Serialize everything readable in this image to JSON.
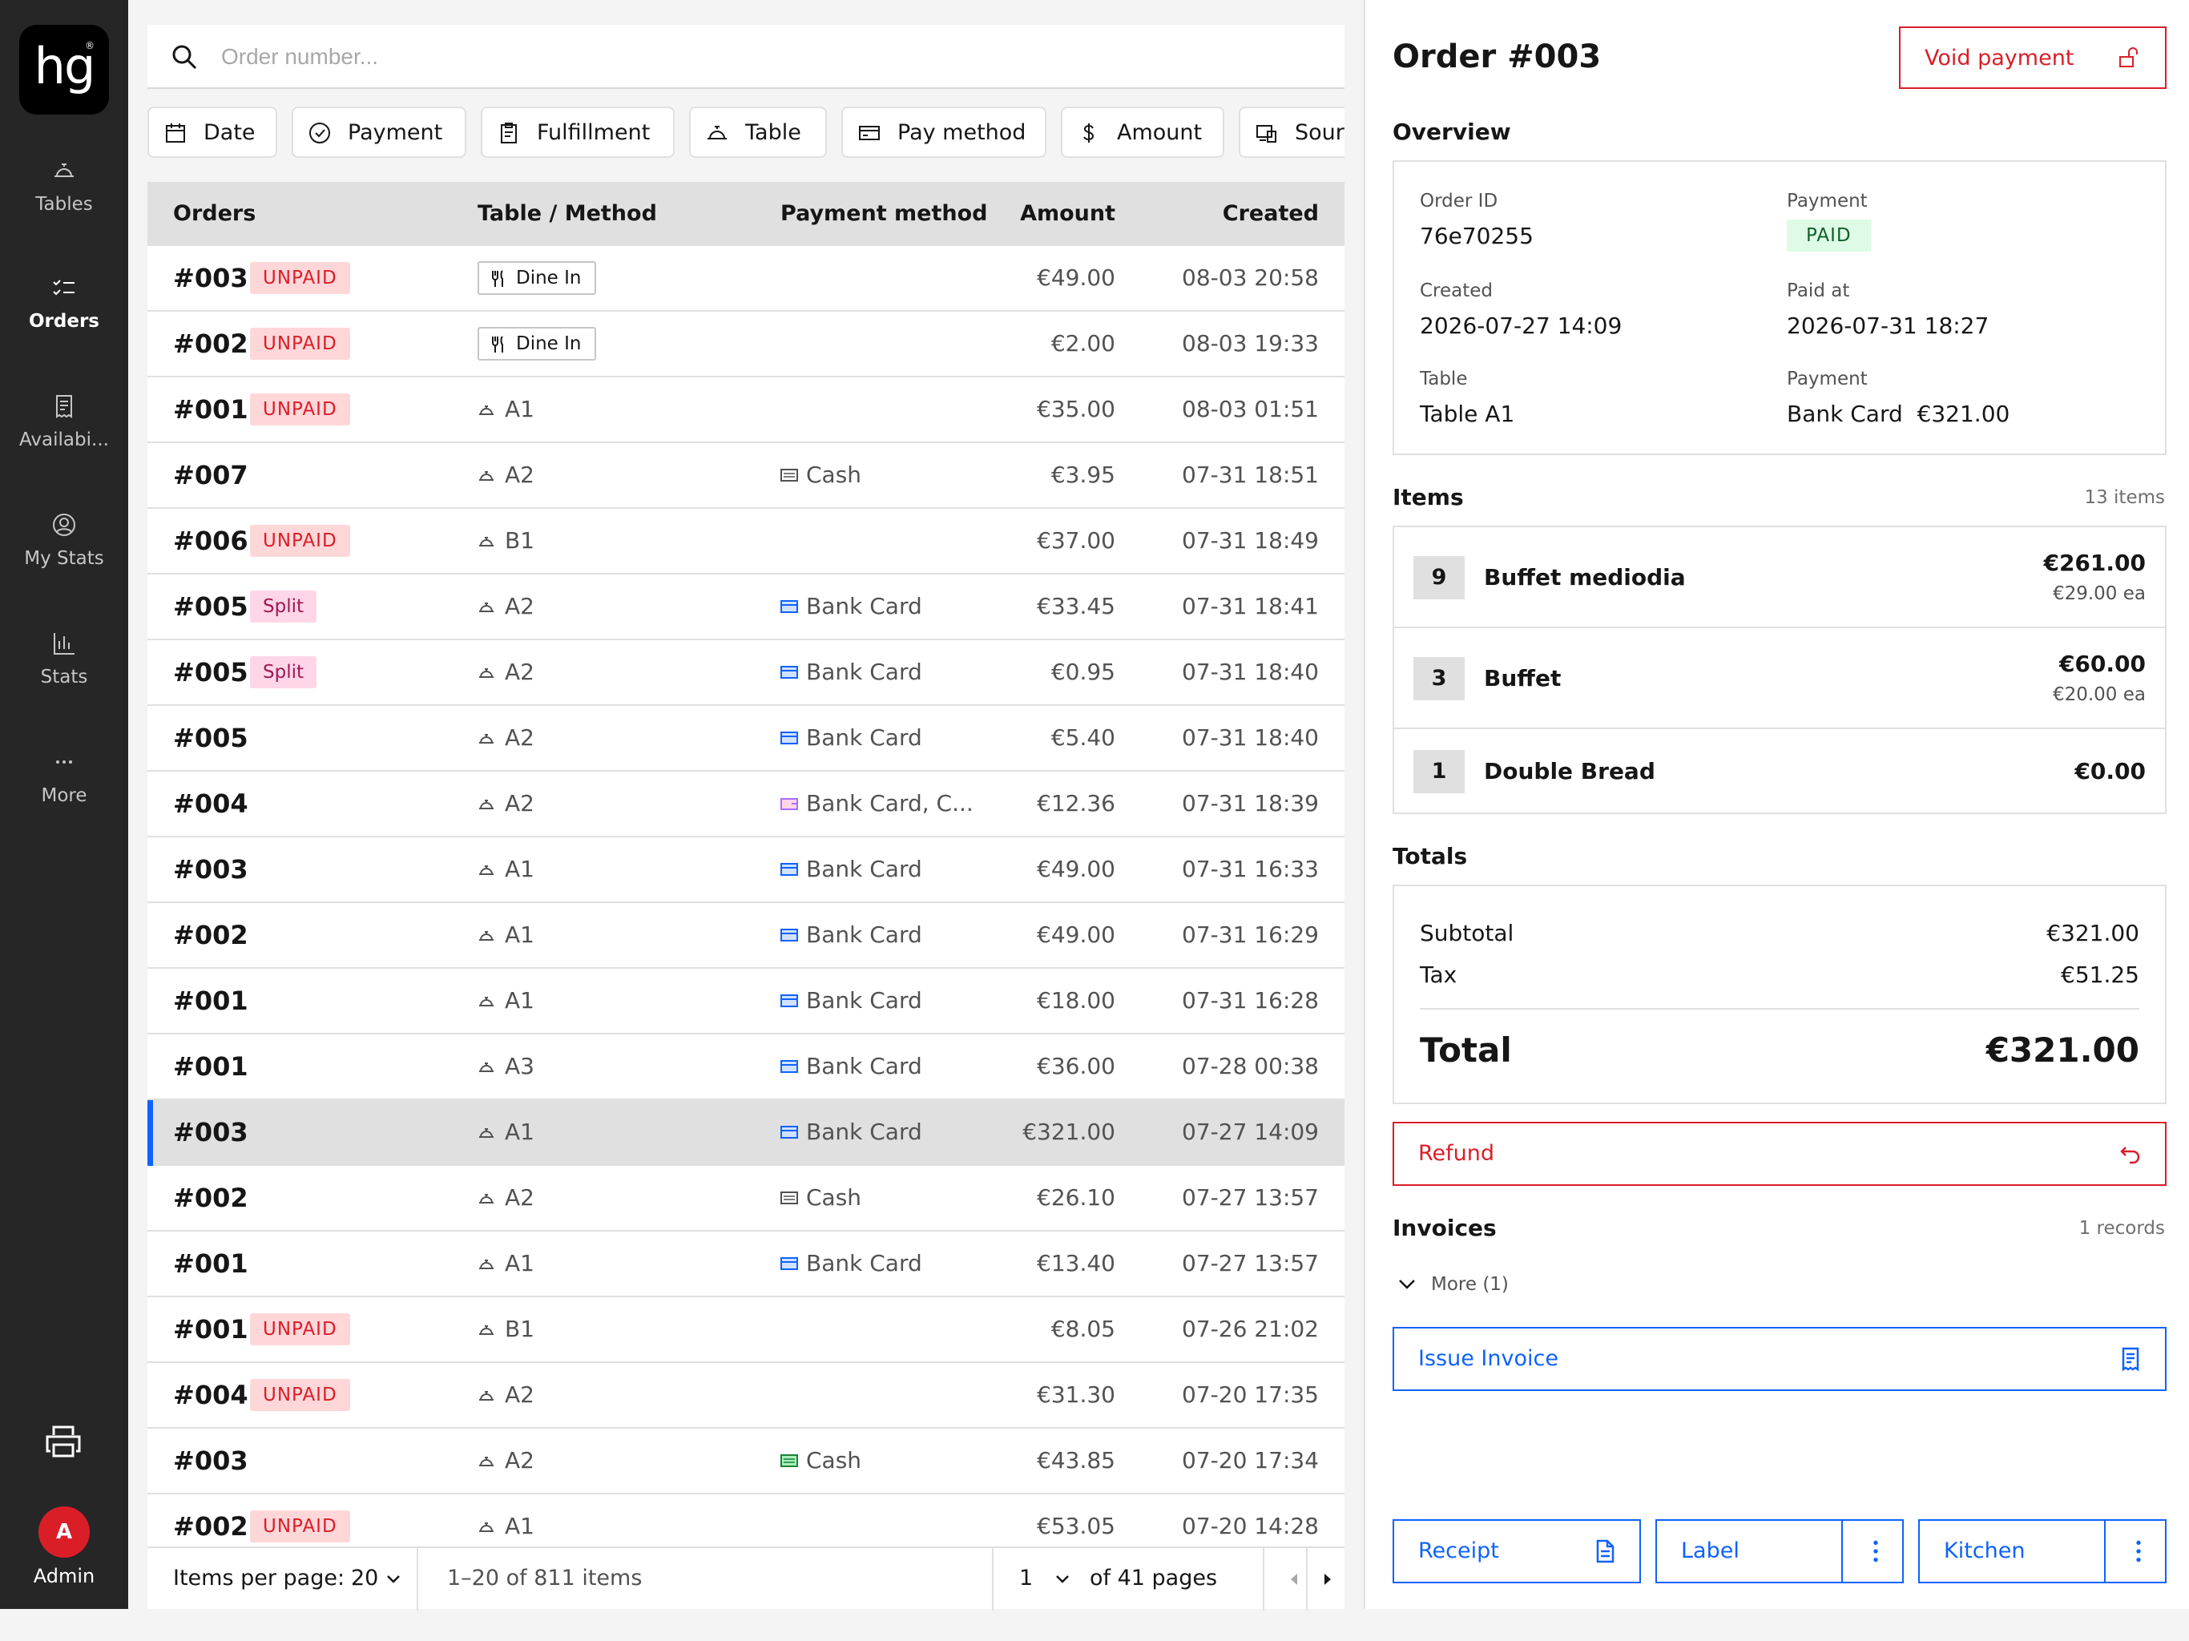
{
  "app": {
    "logo_text": "hg",
    "logo_mark": "®",
    "nav": [
      {
        "label": "Tables",
        "icon": "bell-icon",
        "active": false
      },
      {
        "label": "Orders",
        "icon": "checklist-icon",
        "active": true
      },
      {
        "label": "Availabi...",
        "icon": "receipt-list-icon",
        "active": false
      },
      {
        "label": "My Stats",
        "icon": "user-circle-icon",
        "active": false
      },
      {
        "label": "Stats",
        "icon": "bar-chart-icon",
        "active": false
      },
      {
        "label": "More",
        "icon": "more-dots-icon",
        "active": false
      }
    ],
    "printer_icon": "printer-icon",
    "user": {
      "initial": "A",
      "label": "Admin",
      "color": "#da1e28"
    }
  },
  "search": {
    "placeholder": "Order number..."
  },
  "filters": [
    {
      "label": "Date",
      "icon": "calendar-icon"
    },
    {
      "label": "Payment",
      "icon": "check-circle-icon"
    },
    {
      "label": "Fulfillment",
      "icon": "clipboard-icon"
    },
    {
      "label": "Table",
      "icon": "bell-icon"
    },
    {
      "label": "Pay method",
      "icon": "card-icon"
    },
    {
      "label": "Amount",
      "icon": "dollar-icon"
    },
    {
      "label": "Source",
      "icon": "devices-icon"
    }
  ],
  "table": {
    "columns": [
      "Orders",
      "Table / Method",
      "Payment method",
      "Amount",
      "Created"
    ],
    "rows": [
      {
        "order": "#003",
        "badge": "UNPAID",
        "badge_type": "unpaid",
        "table": "Dine In",
        "method_type": "dinein",
        "payment": "",
        "pay_icon": "",
        "amount": "€49.00",
        "created": "08-03 20:58"
      },
      {
        "order": "#002",
        "badge": "UNPAID",
        "badge_type": "unpaid",
        "table": "Dine In",
        "method_type": "dinein",
        "payment": "",
        "pay_icon": "",
        "amount": "€2.00",
        "created": "08-03 19:33"
      },
      {
        "order": "#001",
        "badge": "UNPAID",
        "badge_type": "unpaid",
        "table": "A1",
        "method_type": "table",
        "payment": "",
        "pay_icon": "",
        "amount": "€35.00",
        "created": "08-03 01:51"
      },
      {
        "order": "#007",
        "badge": "",
        "badge_type": "",
        "table": "A2",
        "method_type": "table",
        "payment": "Cash",
        "pay_icon": "cash",
        "amount": "€3.95",
        "created": "07-31 18:51"
      },
      {
        "order": "#006",
        "badge": "UNPAID",
        "badge_type": "unpaid",
        "table": "B1",
        "method_type": "table",
        "payment": "",
        "pay_icon": "",
        "amount": "€37.00",
        "created": "07-31 18:49"
      },
      {
        "order": "#005",
        "badge": "Split",
        "badge_type": "split",
        "table": "A2",
        "method_type": "table",
        "payment": "Bank Card",
        "pay_icon": "card",
        "amount": "€33.45",
        "created": "07-31 18:41"
      },
      {
        "order": "#005",
        "badge": "Split",
        "badge_type": "split",
        "table": "A2",
        "method_type": "table",
        "payment": "Bank Card",
        "pay_icon": "card",
        "amount": "€0.95",
        "created": "07-31 18:40"
      },
      {
        "order": "#005",
        "badge": "",
        "badge_type": "",
        "table": "A2",
        "method_type": "table",
        "payment": "Bank Card",
        "pay_icon": "card",
        "amount": "€5.40",
        "created": "07-31 18:40"
      },
      {
        "order": "#004",
        "badge": "",
        "badge_type": "",
        "table": "A2",
        "method_type": "table",
        "payment": "Bank Card, C...",
        "pay_icon": "wallet",
        "amount": "€12.36",
        "created": "07-31 18:39"
      },
      {
        "order": "#003",
        "badge": "",
        "badge_type": "",
        "table": "A1",
        "method_type": "table",
        "payment": "Bank Card",
        "pay_icon": "card",
        "amount": "€49.00",
        "created": "07-31 16:33"
      },
      {
        "order": "#002",
        "badge": "",
        "badge_type": "",
        "table": "A1",
        "method_type": "table",
        "payment": "Bank Card",
        "pay_icon": "card",
        "amount": "€49.00",
        "created": "07-31 16:29"
      },
      {
        "order": "#001",
        "badge": "",
        "badge_type": "",
        "table": "A1",
        "method_type": "table",
        "payment": "Bank Card",
        "pay_icon": "card",
        "amount": "€18.00",
        "created": "07-31 16:28"
      },
      {
        "order": "#001",
        "badge": "",
        "badge_type": "",
        "table": "A3",
        "method_type": "table",
        "payment": "Bank Card",
        "pay_icon": "card",
        "amount": "€36.00",
        "created": "07-28 00:38"
      },
      {
        "order": "#003",
        "badge": "",
        "badge_type": "",
        "table": "A1",
        "method_type": "table",
        "payment": "Bank Card",
        "pay_icon": "card",
        "amount": "€321.00",
        "created": "07-27 14:09",
        "selected": true
      },
      {
        "order": "#002",
        "badge": "",
        "badge_type": "",
        "table": "A2",
        "method_type": "table",
        "payment": "Cash",
        "pay_icon": "cash",
        "amount": "€26.10",
        "created": "07-27 13:57"
      },
      {
        "order": "#001",
        "badge": "",
        "badge_type": "",
        "table": "A1",
        "method_type": "table",
        "payment": "Bank Card",
        "pay_icon": "card",
        "amount": "€13.40",
        "created": "07-27 13:57"
      },
      {
        "order": "#001",
        "badge": "UNPAID",
        "badge_type": "unpaid",
        "table": "B1",
        "method_type": "table",
        "payment": "",
        "pay_icon": "",
        "amount": "€8.05",
        "created": "07-26 21:02"
      },
      {
        "order": "#004",
        "badge": "UNPAID",
        "badge_type": "unpaid",
        "table": "A2",
        "method_type": "table",
        "payment": "",
        "pay_icon": "",
        "amount": "€31.30",
        "created": "07-20 17:35"
      },
      {
        "order": "#003",
        "badge": "",
        "badge_type": "",
        "table": "A2",
        "method_type": "table",
        "payment": "Cash",
        "pay_icon": "cash-green",
        "amount": "€43.85",
        "created": "07-20 17:34"
      },
      {
        "order": "#002",
        "badge": "UNPAID",
        "badge_type": "unpaid",
        "table": "A1",
        "method_type": "table",
        "payment": "",
        "pay_icon": "",
        "amount": "€53.05",
        "created": "07-20 14:28"
      }
    ]
  },
  "pagination": {
    "per_page_label": "Items per page:",
    "per_page_value": "20",
    "range_text": "1–20 of 811 items",
    "page_value": "1",
    "pages_text": "of 41 pages"
  },
  "detail": {
    "title": "Order #003",
    "void_label": "Void payment",
    "overview_title": "Overview",
    "overview": {
      "order_id_label": "Order ID",
      "order_id": "76e70255",
      "payment_label": "Payment",
      "payment_status": "PAID",
      "created_label": "Created",
      "created": "2026-07-27 14:09",
      "paid_at_label": "Paid at",
      "paid_at": "2026-07-31 18:27",
      "table_label": "Table",
      "table": "Table A1",
      "payment2_label": "Payment",
      "payment_detail": "Bank Card  €321.00"
    },
    "items_title": "Items",
    "items_count": "13 items",
    "items": [
      {
        "qty": "9",
        "name": "Buffet mediodia",
        "total": "€261.00",
        "each": "€29.00 ea"
      },
      {
        "qty": "3",
        "name": "Buffet",
        "total": "€60.00",
        "each": "€20.00 ea"
      },
      {
        "qty": "1",
        "name": "Double Bread",
        "total": "€0.00",
        "each": ""
      }
    ],
    "totals_title": "Totals",
    "subtotal_label": "Subtotal",
    "subtotal": "€321.00",
    "tax_label": "Tax",
    "tax": "€51.25",
    "total_label": "Total",
    "total": "€321.00",
    "refund_label": "Refund",
    "invoices_title": "Invoices",
    "invoices_count": "1 records",
    "more_label": "More (1)",
    "issue_invoice_label": "Issue Invoice",
    "receipt_label": "Receipt",
    "label_label": "Label",
    "kitchen_label": "Kitchen"
  }
}
